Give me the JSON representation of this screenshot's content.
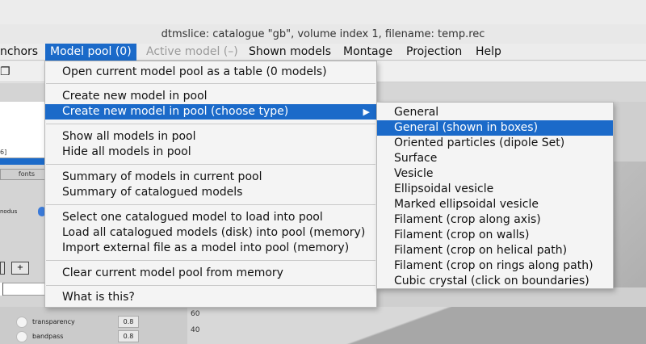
{
  "window": {
    "title": "dtmslice: catalogue \"gb\", volume index 1, filename: temp.rec"
  },
  "menubar": {
    "items": [
      {
        "label": "nchors",
        "state": "normal"
      },
      {
        "label": "Model pool (0)",
        "state": "active"
      },
      {
        "label": "Active model (–)",
        "state": "disabled"
      },
      {
        "label": "Shown models",
        "state": "normal"
      },
      {
        "label": "Montage",
        "state": "normal"
      },
      {
        "label": "Projection",
        "state": "normal"
      },
      {
        "label": "Help",
        "state": "normal"
      }
    ]
  },
  "model_pool_menu": {
    "items": [
      "Open current model pool as a table (0 models)",
      "Create new model in pool",
      "Create new model in pool (choose type)",
      "Show all models in pool",
      "Hide all models in pool",
      "Summary of models in current pool",
      "Summary of catalogued models",
      "Select one catalogued model to load into pool",
      "Load all catalogued models (disk) into pool (memory)",
      "Import external file as a model into pool (memory)",
      "Clear current model pool from memory",
      "What is this?"
    ],
    "highlighted": "Create new model in pool (choose type)",
    "submenu_arrow": "▶"
  },
  "choose_type_submenu": {
    "items": [
      "General",
      "General (shown in boxes)",
      "Oriented particles (dipole Set)",
      "Surface",
      "Vesicle",
      "Ellipsoidal vesicle",
      "Marked ellipsoidal vesicle",
      "Filament (crop along axis)",
      "Filament (crop on walls)",
      "Filament (crop on helical path)",
      "Filament (crop on rings along path)",
      "Cubic crystal (click on boundaries)"
    ],
    "highlighted": "General (shown in boxes)"
  },
  "background": {
    "left_fragment_number": "6]",
    "fonts_tab": "fonts",
    "modus_label": "nodus",
    "plus_button": "+",
    "controls": [
      {
        "label": "transparency",
        "value": "0.8"
      },
      {
        "label": "bandpass",
        "value": "0.8"
      }
    ],
    "y_ticks": [
      "60",
      "40"
    ]
  },
  "colors": {
    "accent": "#1b6ac9",
    "menu_bg": "#f4f4f4",
    "disabled_text": "#9a9a9a"
  },
  "icons": {
    "toolbar_icon": "copy-windows-icon"
  }
}
